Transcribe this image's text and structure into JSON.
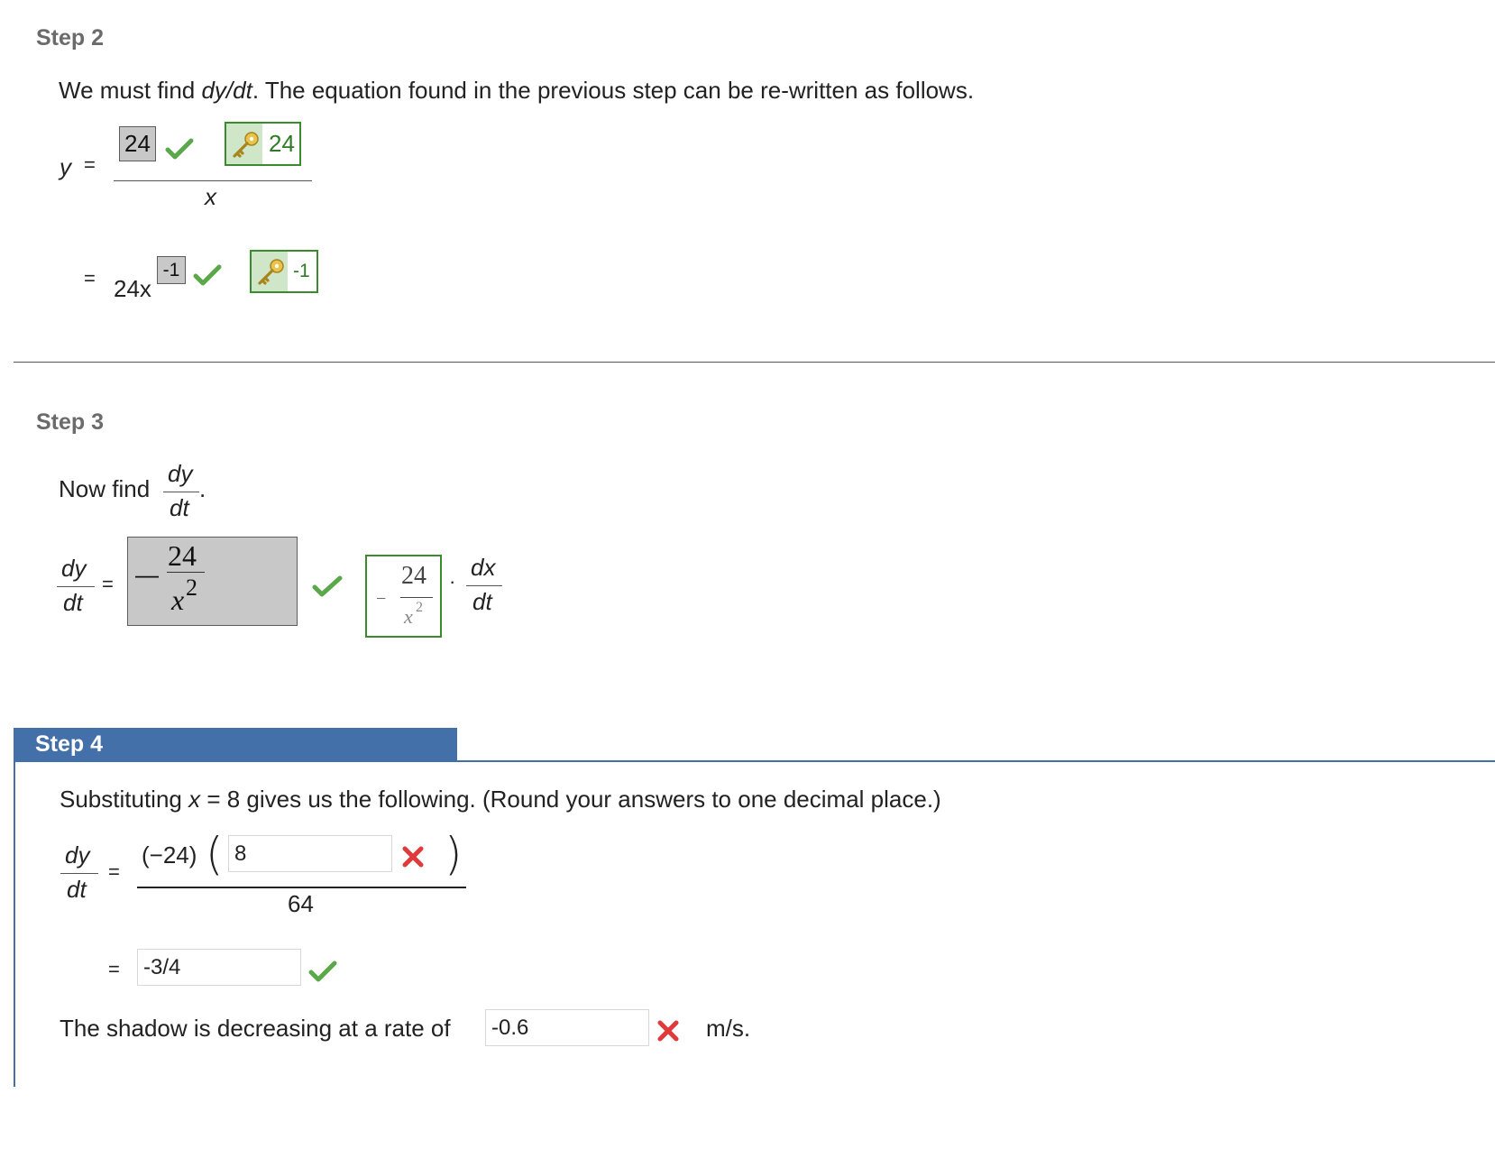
{
  "step2": {
    "title": "Step 2",
    "intro_pre": "We must find ",
    "intro_var": "dy/dt",
    "intro_post": ". The equation found in the previous step can be re-written as follows.",
    "y_label": "y",
    "equals": "=",
    "numerator_answer": "24",
    "numerator_key": "24",
    "denominator": "x",
    "coef_text": "24x",
    "exponent_answer": "-1",
    "exponent_key": "-1"
  },
  "step3": {
    "title": "Step 3",
    "intro": "Now find",
    "frac_num": "dy",
    "frac_den": "dt",
    "period": ".",
    "lhs_num": "dy",
    "lhs_den": "dt",
    "equals": "=",
    "answer_sign": "—",
    "answer_num": "24",
    "answer_den_base": "x",
    "answer_den_exp": "2",
    "key_sign": "−",
    "key_num": "24",
    "key_den_base": "x",
    "key_den_exp": "2",
    "dot": "·",
    "dx_num": "dx",
    "dx_den": "dt"
  },
  "step4": {
    "title": "Step 4",
    "intro_pre": "Substituting ",
    "intro_var": "x",
    "intro_post": " = 8 gives us the following. (Round your answers to one decimal place.)",
    "lhs_num": "dy",
    "lhs_den": "dt",
    "equals": "=",
    "coef": "(−24)",
    "paren_open": "(",
    "paren_close": ")",
    "input1_value": "8",
    "denominator": "64",
    "input2_value": "-3/4",
    "sentence_pre": "The shadow is decreasing at a rate of",
    "input3_value": "-0.6",
    "units": "m/s."
  },
  "colors": {
    "correct": "#5aa84a",
    "incorrect": "#e03a3a",
    "step4_header": "#4470a9",
    "key_border": "#3a8a2e"
  },
  "icons": [
    "check-icon",
    "x-icon",
    "key-icon"
  ]
}
